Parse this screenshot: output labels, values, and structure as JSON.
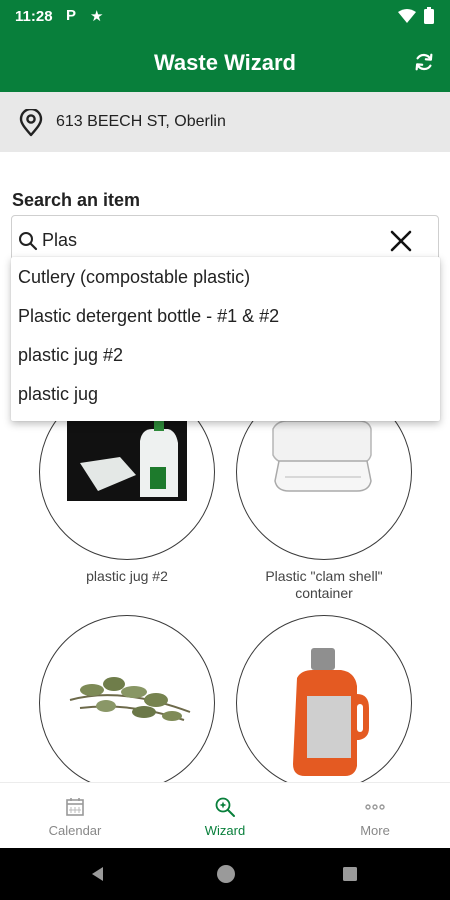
{
  "status_bar": {
    "time": "11:28",
    "icons": [
      "parking-icon",
      "star-icon",
      "wifi-icon",
      "battery-icon"
    ]
  },
  "app_bar": {
    "title": "Waste Wizard",
    "refresh_icon": "refresh-icon"
  },
  "location": {
    "address": "613 BEECH ST, Oberlin",
    "icon": "map-pin-icon"
  },
  "search": {
    "label": "Search an item",
    "value": "Plas",
    "suggestions": [
      "Cutlery (compostable plastic)",
      "Plastic detergent bottle - #1 & #2",
      "plastic jug #2",
      "plastic jug"
    ]
  },
  "items": [
    {
      "label": "plastic jug #2",
      "image": "plastic-jug-photo"
    },
    {
      "label": "Plastic \"clam shell\" container",
      "image": "clamshell-container-photo"
    },
    {
      "label": "",
      "image": "yard-waste-branches-photo"
    },
    {
      "label": "",
      "image": "detergent-bottle-photo"
    }
  ],
  "bottom_nav": {
    "items": [
      {
        "label": "Calendar",
        "icon": "calendar-icon",
        "active": false
      },
      {
        "label": "Wizard",
        "icon": "wizard-search-icon",
        "active": true
      },
      {
        "label": "More",
        "icon": "more-dots-icon",
        "active": false
      }
    ]
  },
  "colors": {
    "brand_green": "#087f3b",
    "address_bg": "#e8e8e8",
    "inactive_nav": "#888888"
  }
}
